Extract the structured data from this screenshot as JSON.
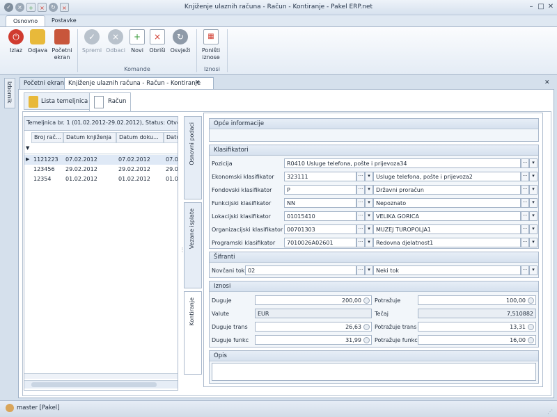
{
  "window": {
    "title": "Knjiženje ulaznih računa - Račun - Kontiranje - Pakel ERP.net"
  },
  "ribbon": {
    "tabs": [
      "Osnovno",
      "Postavke"
    ],
    "buttons": {
      "izlaz": "Izlaz",
      "odjava": "Odjava",
      "pocetni1": "Početni",
      "pocetni2": "ekran",
      "spremi": "Spremi",
      "odbaci": "Odbaci",
      "novi": "Novi",
      "obrisi": "Obriši",
      "osvjezi": "Osvježi",
      "ponisti1": "Poništi",
      "ponisti2": "iznose"
    },
    "groups": {
      "komande": "Komande",
      "iznosi": "Iznosi"
    }
  },
  "side_panel": {
    "label": "Izbornik"
  },
  "doc_tabs": [
    "Početni ekran",
    "Knjiženje ulaznih računa - Račun - Kontiranje"
  ],
  "inner_tabs": [
    "Lista temeljnica",
    "Račun"
  ],
  "grid": {
    "header": "Temeljnica br. 1 (01.02.2012-29.02.2012), Status: Otvo",
    "columns": [
      "Broj rač...",
      "Datum knjiženja",
      "Datum doku...",
      "Datum"
    ],
    "rows": [
      [
        "1121223",
        "07.02.2012",
        "07.02.2012",
        "07.0"
      ],
      [
        "123456",
        "29.02.2012",
        "29.02.2012",
        "29.0"
      ],
      [
        "12354",
        "01.02.2012",
        "01.02.2012",
        "01.0"
      ]
    ]
  },
  "vtabs": [
    "Osnovni podaci",
    "Vezane isplate",
    "Kontiranje"
  ],
  "form": {
    "opce": "Opće informacije",
    "klasifikatori": {
      "title": "Klasifikatori",
      "pozicija_label": "Pozicija",
      "pozicija_value": "R0410 Usluge telefona, pošte i prijevoza34",
      "ekon_label": "Ekonomski klasifikator",
      "ekon_code": "323111",
      "ekon_name": "Usluge telefona, pošte i prijevoza2",
      "fond_label": "Fondovski klasifikator",
      "fond_code": "P",
      "fond_name": "Državni proračun",
      "funk_label": "Funkcijski klasifikator",
      "funk_code": "NN",
      "funk_name": "Nepoznato",
      "lok_label": "Lokacijski klasifikator",
      "lok_code": "01015410",
      "lok_name": "VELIKA GORICA",
      "org_label": "Organizacijski klasifikator",
      "org_code": "00701303",
      "org_name": "MUZEJ TUROPOLJA1",
      "prog_label": "Programski klasifikator",
      "prog_code": "7010026A02601",
      "prog_name": "Redovna djelatnost1"
    },
    "sifranti": {
      "title": "Šifranti",
      "label": "Novčani tok",
      "code": "02",
      "name": "Neki tok"
    },
    "iznosi": {
      "title": "Iznosi",
      "duguje_label": "Duguje",
      "duguje": "200,00",
      "potrazuje_label": "Potražuje",
      "potrazuje": "100,00",
      "valute_label": "Valute",
      "valute": "EUR",
      "tecaj_label": "Tečaj",
      "tecaj": "7,510882",
      "dug_trans_label": "Duguje trans",
      "dug_trans": "26,63",
      "pot_trans_label": "Potražuje trans",
      "pot_trans": "13,31",
      "dug_funkc_label": "Duguje funkc",
      "dug_funkc": "31,99",
      "pot_funkc_label": "Potražuje funkc",
      "pot_funkc": "16,00"
    },
    "opis": "Opis"
  },
  "status": {
    "user": "master [Pakel]"
  },
  "colors": {
    "accent": "#1f6fc4",
    "danger": "#d03b2f",
    "ribbon_bg": "#e4ecf5"
  }
}
